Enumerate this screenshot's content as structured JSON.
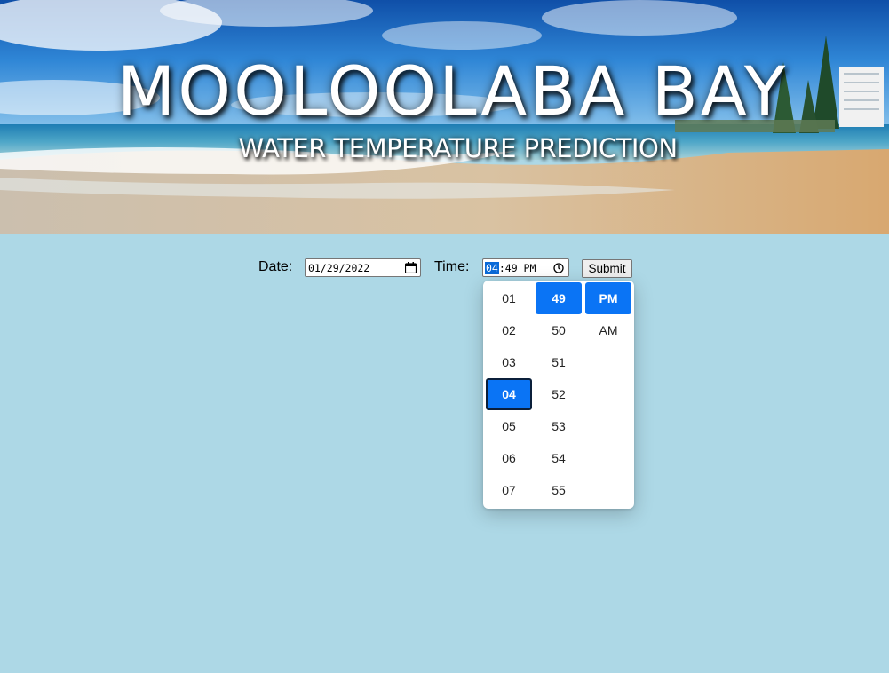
{
  "banner": {
    "title": "MOOLOOLABA BAY",
    "subtitle": "WATER TEMPERATURE PREDICTION"
  },
  "form": {
    "date_label": "Date:",
    "date_value": "01/29/2022",
    "time_label": "Time:",
    "time_hour": "04",
    "time_rest": ":49 PM",
    "submit_label": "Submit"
  },
  "time_picker": {
    "hours": [
      "01",
      "02",
      "03",
      "04",
      "05",
      "06",
      "07"
    ],
    "minutes": [
      "49",
      "50",
      "51",
      "52",
      "53",
      "54",
      "55"
    ],
    "periods": [
      "PM",
      "AM"
    ],
    "selected_hour": "04",
    "selected_minute": "49",
    "selected_period": "PM"
  },
  "colors": {
    "page_background": "#add8e6",
    "selection": "#0a74f5"
  },
  "icons": [
    "calendar-icon",
    "clock-icon"
  ]
}
